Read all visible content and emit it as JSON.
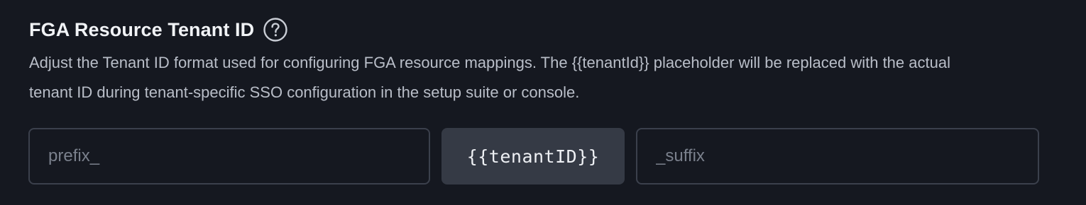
{
  "section": {
    "title": "FGA Resource Tenant ID",
    "help_icon": "question-circle-icon",
    "description": "Adjust the Tenant ID format used for configuring FGA resource mappings. The {{tenantId}} placeholder will be replaced with the actual tenant ID during tenant-specific SSO configuration in the setup suite or console."
  },
  "tenant_format": {
    "prefix": {
      "value": "",
      "placeholder": "prefix_"
    },
    "token": "{{tenantID}}",
    "suffix": {
      "value": "",
      "placeholder": "_suffix"
    }
  },
  "colors": {
    "background": "#151820",
    "field_border": "#3b404c",
    "token_background": "#353a45",
    "title_text": "#f1f3f6",
    "description_text": "#b9bec8",
    "placeholder_text": "#7a808c"
  }
}
